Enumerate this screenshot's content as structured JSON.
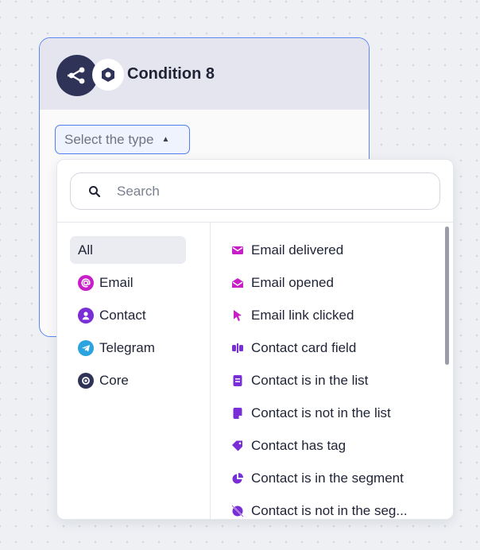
{
  "node": {
    "title": "Condition 8",
    "main_icon": "share-nodes-icon",
    "sub_icon": "core-icon",
    "select_placeholder": "Select the type",
    "accent_color": "#5b86f5"
  },
  "dropdown": {
    "search_placeholder": "Search",
    "categories": [
      {
        "label": "All",
        "icon": null,
        "active": true
      },
      {
        "label": "Email",
        "icon": "at-icon",
        "color": "#c81ec8"
      },
      {
        "label": "Contact",
        "icon": "person-icon",
        "color": "#7a2fd6"
      },
      {
        "label": "Telegram",
        "icon": "telegram-icon",
        "color": "#2aa3de"
      },
      {
        "label": "Core",
        "icon": "core-icon",
        "color": "#2f3358"
      }
    ],
    "events": [
      {
        "label": "Email delivered",
        "icon": "envelope-icon",
        "color": "#c81ec8"
      },
      {
        "label": "Email opened",
        "icon": "envelope-open-icon",
        "color": "#c81ec8"
      },
      {
        "label": "Email link clicked",
        "icon": "cursor-icon",
        "color": "#c81ec8"
      },
      {
        "label": "Contact card field",
        "icon": "text-cursor-icon",
        "color": "#7a2fd6"
      },
      {
        "label": "Contact is in the list",
        "icon": "list-file-icon",
        "color": "#7a2fd6"
      },
      {
        "label": "Contact is not in the list",
        "icon": "note-icon",
        "color": "#7a2fd6"
      },
      {
        "label": "Contact has tag",
        "icon": "tag-icon",
        "color": "#7a2fd6"
      },
      {
        "label": "Contact is in the segment",
        "icon": "pie-chart-icon",
        "color": "#7a2fd6"
      },
      {
        "label": "Contact is not in the seg...",
        "icon": "pie-chart-slash-icon",
        "color": "#7a2fd6"
      }
    ]
  }
}
